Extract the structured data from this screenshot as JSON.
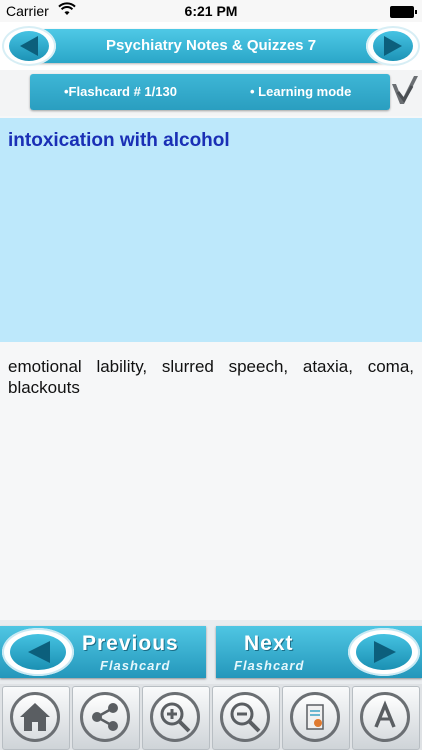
{
  "status_bar": {
    "carrier": "Carrier",
    "time": "6:21 PM"
  },
  "header": {
    "title": "Psychiatry Notes & Quizzes 7"
  },
  "info": {
    "flashcard_count": "•Flashcard #  1/130",
    "mode": "•  Learning mode"
  },
  "card": {
    "question": "intoxication with alcohol",
    "answer": "emotional lability, slurred speech, ataxia, coma, blackouts"
  },
  "navigation": {
    "previous_label": "Previous",
    "previous_sub": "Flashcard",
    "next_label": "Next",
    "next_sub": "Flashcard"
  },
  "toolbar": {
    "icons": [
      "home-icon",
      "share-icon",
      "zoom-in-icon",
      "zoom-out-icon",
      "document-icon",
      "font-icon"
    ]
  },
  "colors": {
    "accent": "#2aa6c8",
    "question_bg": "#bde8fb",
    "question_text": "#1a2fb5"
  }
}
